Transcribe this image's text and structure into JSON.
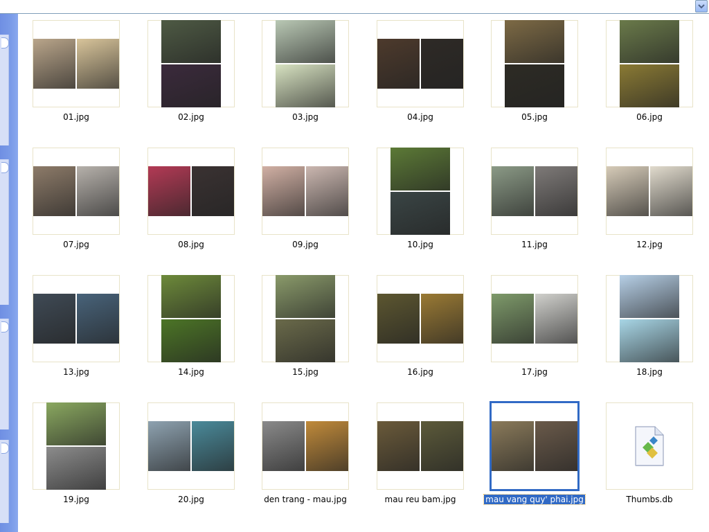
{
  "colors": {
    "selection": "#316ac5",
    "taskpane": "#7a9be8"
  },
  "toolbar": {
    "dropdown_icon": "chevron-down-icon"
  },
  "files": [
    {
      "name": "01.jpg",
      "layout": "h",
      "c1": "#b9a58a",
      "c2": "#d8c49a"
    },
    {
      "name": "02.jpg",
      "layout": "v",
      "c1": "#4e5a44",
      "c2": "#3b2a3c"
    },
    {
      "name": "03.jpg",
      "layout": "v",
      "c1": "#b9c8b4",
      "c2": "#d7e2c1"
    },
    {
      "name": "04.jpg",
      "layout": "h",
      "c1": "#4d3a2c",
      "c2": "#2e2a26"
    },
    {
      "name": "05.jpg",
      "layout": "v",
      "c1": "#7d6a45",
      "c2": "#2d2b24"
    },
    {
      "name": "06.jpg",
      "layout": "v",
      "c1": "#6a7a4a",
      "c2": "#8a7a34"
    },
    {
      "name": "07.jpg",
      "layout": "h",
      "c1": "#8d7b69",
      "c2": "#b6b1ab"
    },
    {
      "name": "08.jpg",
      "layout": "h",
      "c1": "#b33a55",
      "c2": "#3a3232"
    },
    {
      "name": "09.jpg",
      "layout": "h",
      "c1": "#d1b0a4",
      "c2": "#cbb7b0"
    },
    {
      "name": "10.jpg",
      "layout": "v",
      "c1": "#5c7a36",
      "c2": "#3a4545"
    },
    {
      "name": "11.jpg",
      "layout": "h",
      "c1": "#8b9a86",
      "c2": "#7e7a78"
    },
    {
      "name": "12.jpg",
      "layout": "h",
      "c1": "#d6cbb8",
      "c2": "#e1dbcd"
    },
    {
      "name": "13.jpg",
      "layout": "h",
      "c1": "#3f4a55",
      "c2": "#48637a"
    },
    {
      "name": "14.jpg",
      "layout": "v",
      "c1": "#6d8a3a",
      "c2": "#4c7526"
    },
    {
      "name": "15.jpg",
      "layout": "v",
      "c1": "#8a9a6a",
      "c2": "#6a6a4a"
    },
    {
      "name": "16.jpg",
      "layout": "h",
      "c1": "#5c5630",
      "c2": "#9a7a34"
    },
    {
      "name": "17.jpg",
      "layout": "h",
      "c1": "#7e9a6a",
      "c2": "#d0d0cc"
    },
    {
      "name": "18.jpg",
      "layout": "v",
      "c1": "#b6cfe6",
      "c2": "#a8d6e6"
    },
    {
      "name": "19.jpg",
      "layout": "v",
      "c1": "#8aa860",
      "c2": "#8c8c8c"
    },
    {
      "name": "20.jpg",
      "layout": "h",
      "c1": "#8ea2b0",
      "c2": "#4a8a9a"
    },
    {
      "name": "den trang - mau.jpg",
      "layout": "h",
      "c1": "#8a8a8a",
      "c2": "#c08a3a"
    },
    {
      "name": "mau reu bam.jpg",
      "layout": "h",
      "c1": "#6a5a3a",
      "c2": "#5c5a3a"
    },
    {
      "name": "mau vang quy' phai.jpg",
      "layout": "h",
      "c1": "#8a7a5a",
      "c2": "#6a5a4a",
      "selected": true
    },
    {
      "name": "Thumbs.db",
      "layout": "icon",
      "icon": "database-file-icon"
    }
  ]
}
